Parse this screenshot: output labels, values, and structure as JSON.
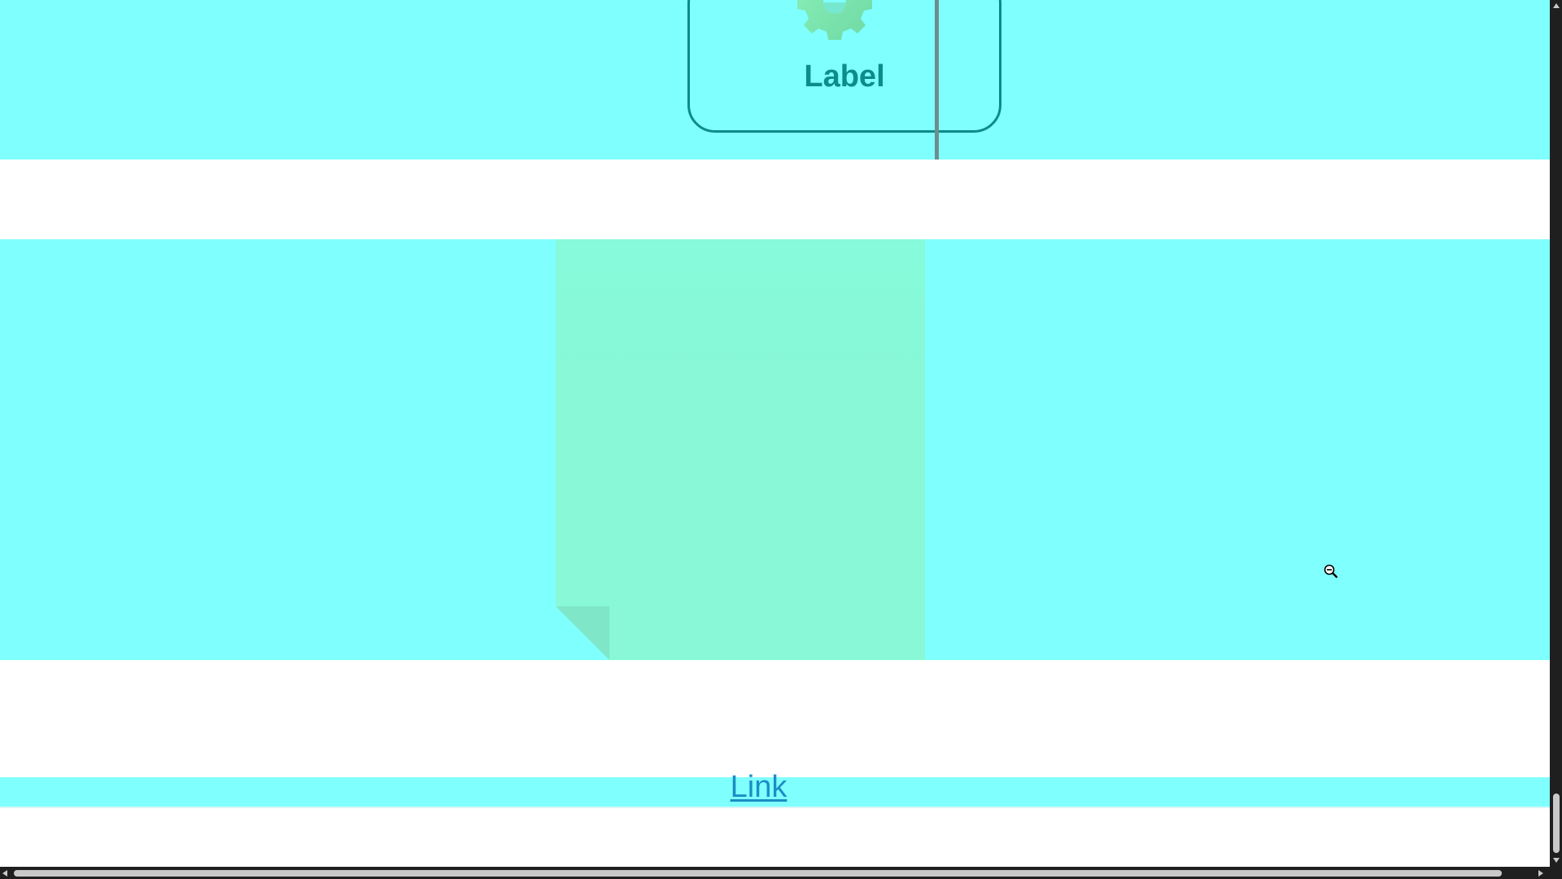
{
  "card": {
    "label": "Label",
    "icon": "gear-icon",
    "border_color": "#0e8a8a",
    "label_color": "#0d8c8c"
  },
  "main": {
    "link_text": "Link",
    "link_color": "#1a8ec4"
  },
  "colors": {
    "band_background": "#80ffff",
    "page_background": "#ffffff",
    "sheet_color": "#88f8d6",
    "gear_color": "#7ee8b0"
  },
  "cursor": {
    "icon": "zoom-out-icon"
  }
}
